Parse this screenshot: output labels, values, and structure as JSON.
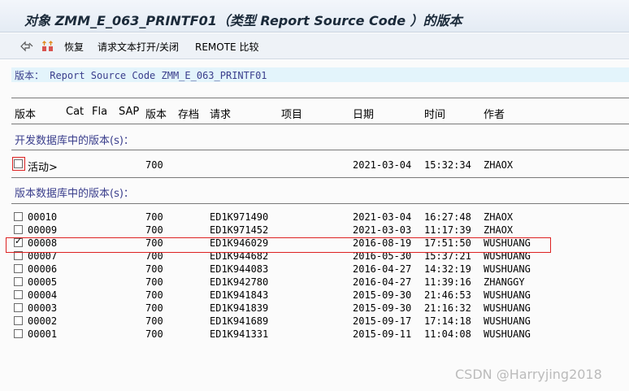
{
  "title": "对象 ZMM_E_063_PRINTF01（类型 Report Source Code ）的版本",
  "toolbar": {
    "restore_label": "恢复",
    "request_label": "请求文本打开/关闭",
    "remote_label": "REMOTE 比较"
  },
  "version_header": "版本： Report Source Code ZMM_E_063_PRINTF01",
  "columns": [
    "版本",
    "Cat",
    "Fla",
    "SAP",
    "版本",
    "存档",
    "请求",
    "项目",
    "日期",
    "时间",
    "作者"
  ],
  "dev_section_label": "开发数据库中的版本(s)：",
  "active_row": {
    "version": "活动>",
    "release": "700",
    "date": "2021-03-04",
    "time": "15:32:34",
    "author": "ZHAOX",
    "checked": false
  },
  "db_section_label": "版本数据库中的版本(s)：",
  "rows": [
    {
      "version": "00010",
      "release": "700",
      "request": "ED1K971490",
      "date": "2021-03-04",
      "time": "16:27:48",
      "author": "ZHAOX",
      "checked": false
    },
    {
      "version": "00009",
      "release": "700",
      "request": "ED1K971452",
      "date": "2021-03-03",
      "time": "11:17:39",
      "author": "ZHAOX",
      "checked": false
    },
    {
      "version": "00008",
      "release": "700",
      "request": "ED1K946029",
      "date": "2016-08-19",
      "time": "17:51:50",
      "author": "WUSHUANG",
      "checked": true
    },
    {
      "version": "00007",
      "release": "700",
      "request": "ED1K944682",
      "date": "2016-05-30",
      "time": "15:37:21",
      "author": "WUSHUANG",
      "checked": false
    },
    {
      "version": "00006",
      "release": "700",
      "request": "ED1K944083",
      "date": "2016-04-27",
      "time": "14:32:19",
      "author": "WUSHUANG",
      "checked": false
    },
    {
      "version": "00005",
      "release": "700",
      "request": "ED1K942780",
      "date": "2016-04-27",
      "time": "11:39:16",
      "author": "ZHANGGY",
      "checked": false
    },
    {
      "version": "00004",
      "release": "700",
      "request": "ED1K941843",
      "date": "2015-09-30",
      "time": "21:46:53",
      "author": "WUSHUANG",
      "checked": false
    },
    {
      "version": "00003",
      "release": "700",
      "request": "ED1K941839",
      "date": "2015-09-30",
      "time": "21:16:32",
      "author": "WUSHUANG",
      "checked": false
    },
    {
      "version": "00002",
      "release": "700",
      "request": "ED1K941689",
      "date": "2015-09-17",
      "time": "17:14:18",
      "author": "WUSHUANG",
      "checked": false
    },
    {
      "version": "00001",
      "release": "700",
      "request": "ED1K941331",
      "date": "2015-09-11",
      "time": "11:04:08",
      "author": "WUSHUANG",
      "checked": false
    }
  ],
  "watermark": "CSDN @Harryjing2018",
  "colors": {
    "accent_text": "#3a3e8c",
    "header_bg": "#e3f4fb",
    "highlight_box": "#dd2222"
  },
  "icons": [
    "other-version-icon",
    "restore-icon"
  ]
}
